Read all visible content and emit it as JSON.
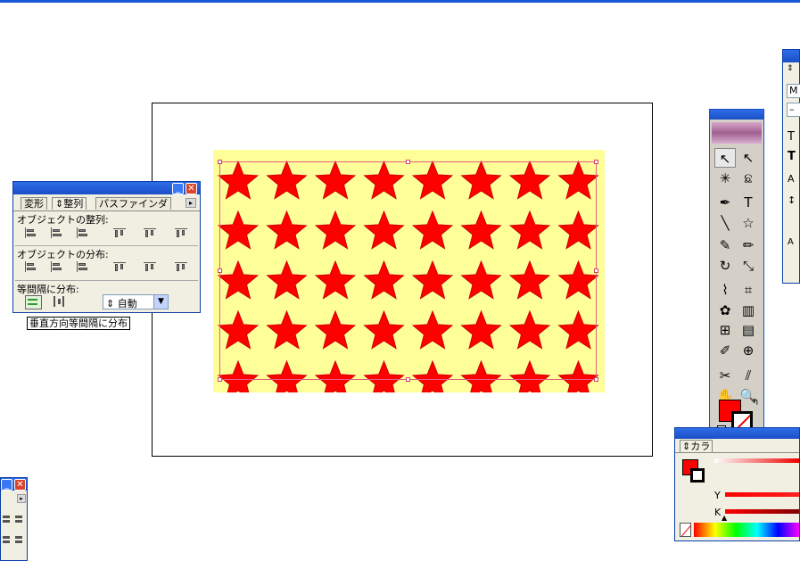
{
  "align_panel": {
    "tabs": [
      "変形",
      "⇕整列",
      "パスファインダ"
    ],
    "section_align": "オブジェクトの整列:",
    "section_distribute": "オブジェクトの分布:",
    "section_spacing": "等間隔に分布:",
    "spacing_value": "⇕ 自動",
    "tooltip": "垂直方向等間隔に分布",
    "align_icons": [
      "align-left-icon",
      "align-hcenter-icon",
      "align-right-icon",
      "align-top-icon",
      "align-vcenter-icon",
      "align-bottom-icon"
    ],
    "distribute_icons": [
      "dist-top-icon",
      "dist-vcenter-icon",
      "dist-bottom-icon",
      "dist-left-icon",
      "dist-hcenter-icon",
      "dist-right-icon"
    ]
  },
  "artwork": {
    "background_color": "#ffff99",
    "star_color": "#ff0000",
    "star_rows": 5,
    "star_columns": 8
  },
  "toolbox": {
    "tools": [
      "selection-tool",
      "direct-selection-tool",
      "magic-wand-tool",
      "lasso-tool",
      "pen-tool",
      "type-tool",
      "line-tool",
      "star-tool",
      "paintbrush-tool",
      "pencil-tool",
      "rotate-tool",
      "scale-tool",
      "warp-tool",
      "free-transform-tool",
      "symbol-sprayer-tool",
      "graph-tool",
      "mesh-tool",
      "gradient-tool",
      "eyedropper-tool",
      "blend-tool",
      "scissors-tool",
      "knife-tool",
      "hand-tool",
      "zoom-tool"
    ],
    "fill_color": "#ff0000"
  },
  "color_panel": {
    "tab": "⇕カラ",
    "channel_y": "Y",
    "channel_k": "K"
  },
  "swatch_panel": {
    "letter_m": "M",
    "letter_dash": "–"
  }
}
